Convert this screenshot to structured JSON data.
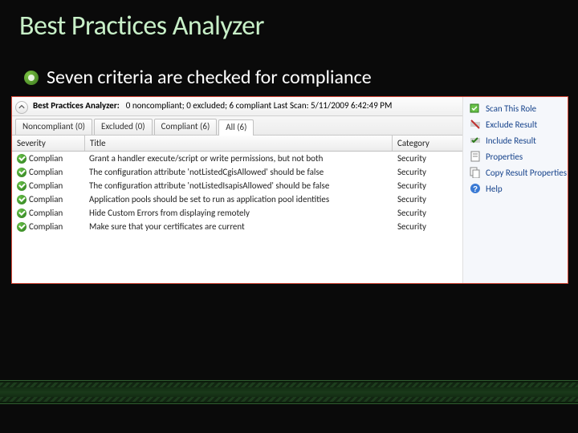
{
  "slide": {
    "title": "Best Practices Analyzer",
    "bullet": "Seven criteria are checked for compliance"
  },
  "panel": {
    "header_label": "Best Practices Analyzer:",
    "header_status": "0 noncompliant; 0 excluded; 6 compliant  Last Scan: 5/11/2009 6:42:49 PM",
    "tabs": [
      {
        "label": "Noncompliant (0)",
        "active": false
      },
      {
        "label": "Excluded (0)",
        "active": false
      },
      {
        "label": "Compliant (6)",
        "active": false
      },
      {
        "label": "All (6)",
        "active": true
      }
    ],
    "columns": {
      "severity": "Severity",
      "title": "Title",
      "category": "Category"
    },
    "rows": [
      {
        "severity": "Complian",
        "title": "Grant a handler execute/script or write permissions, but not both",
        "category": "Security"
      },
      {
        "severity": "Complian",
        "title": "The configuration attribute 'notListedCgisAllowed' should be false",
        "category": "Security"
      },
      {
        "severity": "Complian",
        "title": "The configuration attribute 'notListedIsapisAllowed' should be false",
        "category": "Security"
      },
      {
        "severity": "Complian",
        "title": "Application pools should be set to run as application pool identities",
        "category": "Security"
      },
      {
        "severity": "Complian",
        "title": "Hide Custom Errors from displaying remotely",
        "category": "Security"
      },
      {
        "severity": "Complian",
        "title": "Make sure that your certificates are current",
        "category": "Security"
      }
    ]
  },
  "actions": [
    {
      "icon": "scan",
      "label": "Scan This Role"
    },
    {
      "icon": "exclude",
      "label": "Exclude Result"
    },
    {
      "icon": "include",
      "label": "Include Result"
    },
    {
      "icon": "props",
      "label": "Properties"
    },
    {
      "icon": "copy",
      "label": "Copy Result Properties"
    },
    {
      "icon": "help",
      "label": "Help"
    }
  ]
}
